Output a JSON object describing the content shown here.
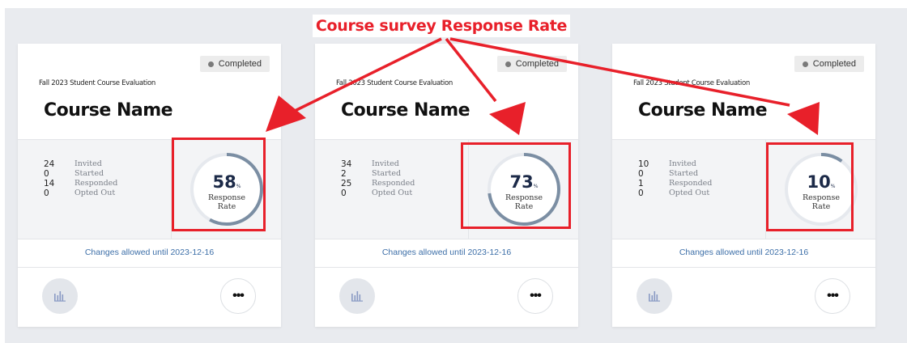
{
  "annotation": {
    "title": "Course survey Response Rate",
    "color": "#e8202a"
  },
  "cards": [
    {
      "status": "Completed",
      "survey_name": "Fall 2023 Student Course Evaluation",
      "course_name": "Course Name",
      "stats": [
        {
          "value": "24",
          "label": "Invited"
        },
        {
          "value": "0",
          "label": "Started"
        },
        {
          "value": "14",
          "label": "Responded"
        },
        {
          "value": "0",
          "label": "Opted Out"
        }
      ],
      "response_rate": 58,
      "pct_text": "58",
      "pct_suffix": "%",
      "rate_label_1": "Response",
      "rate_label_2": "Rate",
      "changes": "Changes allowed until 2023-12-16",
      "report_icon": "bar-chart-icon",
      "more_icon": "ellipsis-icon",
      "more_label": "•••"
    },
    {
      "status": "Completed",
      "survey_name": "Fall 2023 Student Course Evaluation",
      "course_name": "Course Name",
      "stats": [
        {
          "value": "34",
          "label": "Invited"
        },
        {
          "value": "2",
          "label": "Started"
        },
        {
          "value": "25",
          "label": "Responded"
        },
        {
          "value": "0",
          "label": "Opted Out"
        }
      ],
      "response_rate": 73,
      "pct_text": "73",
      "pct_suffix": "%",
      "rate_label_1": "Response",
      "rate_label_2": "Rate",
      "changes": "Changes allowed until 2023-12-16",
      "report_icon": "bar-chart-icon",
      "more_icon": "ellipsis-icon",
      "more_label": "•••"
    },
    {
      "status": "Completed",
      "survey_name": "Fall 2023 Student Course Evaluation",
      "course_name": "Course Name",
      "stats": [
        {
          "value": "10",
          "label": "Invited"
        },
        {
          "value": "0",
          "label": "Started"
        },
        {
          "value": "1",
          "label": "Responded"
        },
        {
          "value": "0",
          "label": "Opted Out"
        }
      ],
      "response_rate": 10,
      "pct_text": "10",
      "pct_suffix": "%",
      "rate_label_1": "Response",
      "rate_label_2": "Rate",
      "changes": "Changes allowed until 2023-12-16",
      "report_icon": "bar-chart-icon",
      "more_icon": "ellipsis-icon",
      "more_label": "•••"
    }
  ],
  "colors": {
    "ring_fill": "#7b8ea3",
    "ring_track": "#e6e9ee",
    "link": "#3d6fa8",
    "highlight": "#e8202a"
  }
}
